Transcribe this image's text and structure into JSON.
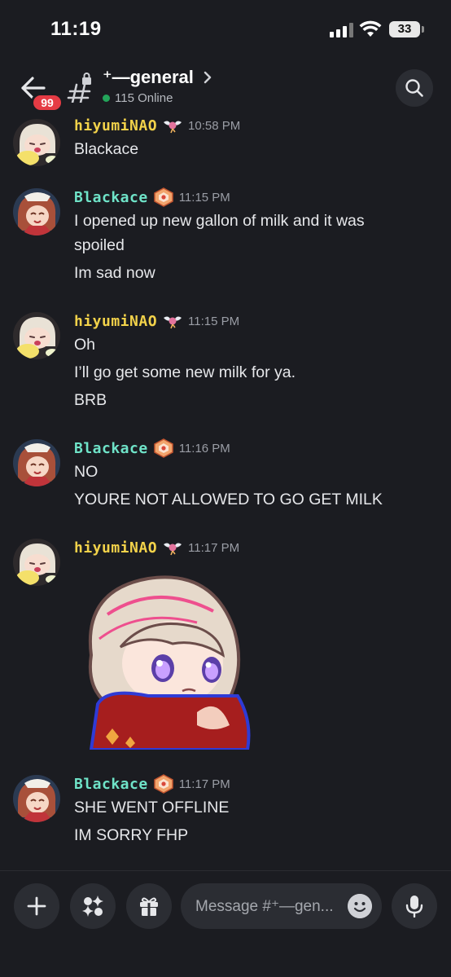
{
  "status_bar": {
    "time": "11:19",
    "battery": "33"
  },
  "header": {
    "badge": "99",
    "channel_name": "⁺—general",
    "online": "115 Online"
  },
  "messages": [
    {
      "user": "hiyumiNAO",
      "time": "10:58 PM",
      "lines": [
        "Blackace"
      ]
    },
    {
      "user": "Blackace",
      "time": "11:15 PM",
      "lines": [
        "I opened up new gallon of milk and it was",
        "spoiled",
        "Im sad now"
      ]
    },
    {
      "user": "hiyumiNAO",
      "time": "11:15 PM",
      "lines": [
        "Oh",
        "I’ll go get some new milk for ya.",
        "BRB"
      ]
    },
    {
      "user": "Blackace",
      "time": "11:16 PM",
      "lines": [
        "NO",
        "YOURE NOT ALLOWED TO GO GET MILK"
      ]
    },
    {
      "user": "hiyumiNAO",
      "time": "11:17 PM",
      "lines": []
    },
    {
      "user": "Blackace",
      "time": "11:17 PM",
      "lines": [
        "SHE WENT OFFLINE",
        "IM SORRY FHP"
      ]
    }
  ],
  "composer": {
    "placeholder": "Message #⁺—gen..."
  },
  "colors": {
    "background": "#1b1c21",
    "yellow_name": "#f2d24a",
    "teal_name": "#6fe3c8",
    "badge": "#e53b44",
    "online": "#23a55a"
  }
}
